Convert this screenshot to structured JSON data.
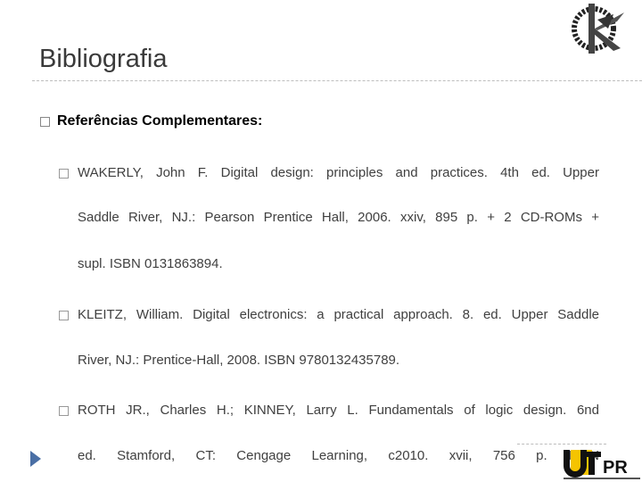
{
  "slide": {
    "title": "Bibliografia",
    "heading": "Referências Complementares:",
    "references": [
      {
        "lines": [
          "WAKERLY, John F. Digital design: principles and practices. 4th ed. Upper",
          "Saddle River, NJ.: Pearson Prentice Hall, 2006. xxiv, 895 p. + 2 CD-ROMs +",
          "supl. ISBN 0131863894."
        ]
      },
      {
        "lines": [
          "KLEITZ, William. Digital electronics: a practical approach. 8. ed. Upper Saddle",
          "River, NJ.: Prentice-Hall, 2008. ISBN 9780132435789."
        ]
      },
      {
        "lines": [
          "ROTH JR., Charles H.; KINNEY, Larry L. Fundamentals of logic design. 6nd",
          "ed. Stamford, CT: Cengage Learning, c2010. xvii, 756 p. ISBN"
        ]
      }
    ],
    "logos": {
      "top": "Engenharia Eletrônica",
      "bottom": "UTFPR"
    },
    "colors": {
      "title": "#3a3a3a",
      "text": "#404040",
      "nav_arrow": "#4a6fa5",
      "utfpr_yellow": "#f5c400"
    }
  }
}
